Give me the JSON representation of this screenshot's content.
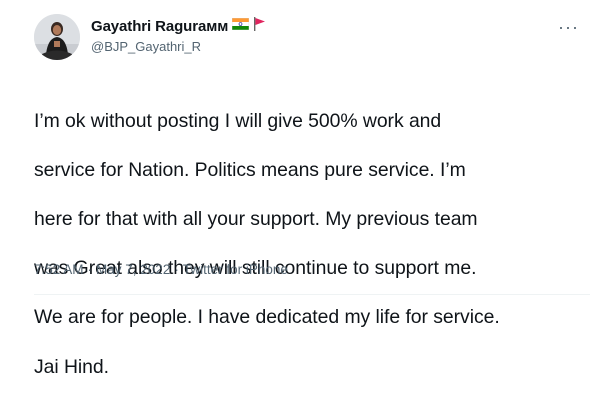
{
  "author": {
    "display_name": "Gayathri Ragurамм",
    "handle": "@BJP_Gayathri_R"
  },
  "tweet": {
    "lines": [
      "I’m ok without posting I will give 500% work and",
      "service for Nation. Politics means pure service. I’m",
      "here for that with all your support. My previous team",
      "was Great also they will still continue to support me.",
      "We are for people. I have dedicated my life for service.",
      "Jai Hind."
    ],
    "time": "7:52 AM",
    "separator": "·",
    "date": "May 7, 2022",
    "source": "Twitter for iPhone"
  },
  "icons": {
    "flag_1": "india-flag-icon",
    "flag_2": "party-flag-icon",
    "more": "more-options-icon"
  },
  "colors": {
    "text": "#0f1419",
    "secondary": "#536471",
    "divider": "#eff3f4"
  }
}
